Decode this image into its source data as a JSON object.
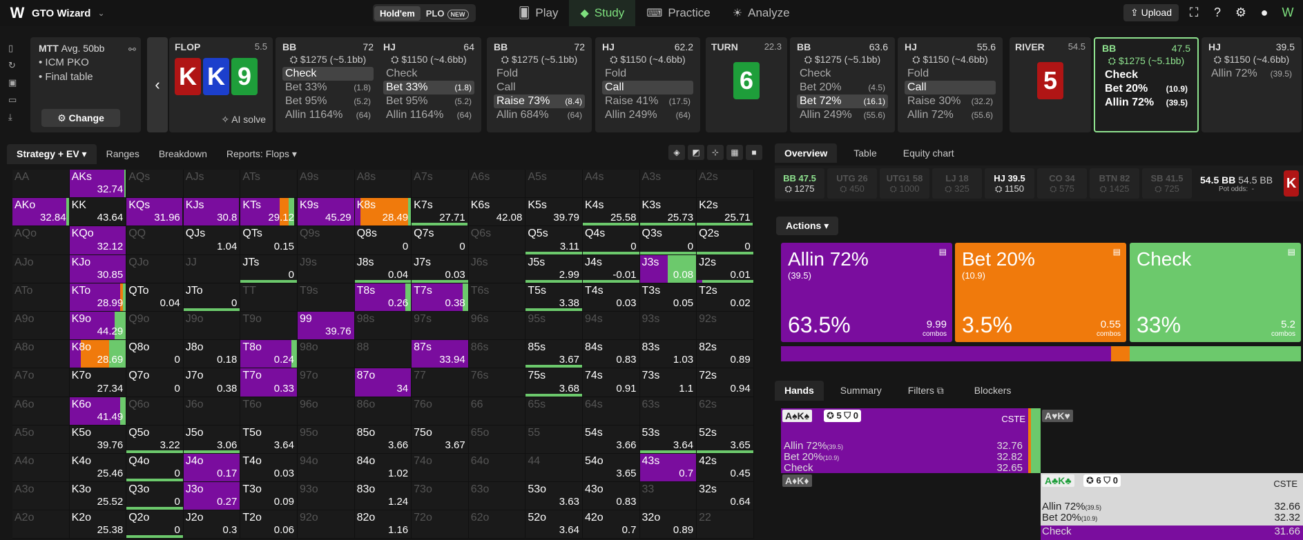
{
  "top": {
    "brand": "GTO Wizard",
    "holdem": "Hold'em",
    "plo": "PLO",
    "new_badge": "NEW",
    "nav": [
      "Play",
      "Study",
      "Practice",
      "Analyze"
    ],
    "upload": "Upload"
  },
  "spot": {
    "format": "MTT",
    "depth": "Avg. 50bb",
    "options": [
      "ICM PKO",
      "Final table"
    ],
    "change": "Change"
  },
  "streets": {
    "flop": {
      "label": "FLOP",
      "pot": "5.5",
      "cards": [
        "K",
        "K",
        "9"
      ],
      "ai": "AI solve"
    },
    "turn": {
      "label": "TURN",
      "pot": "22.3",
      "cards": [
        "6"
      ]
    },
    "river": {
      "label": "RIVER",
      "pot": "54.5",
      "cards": [
        "5"
      ]
    }
  },
  "players": [
    {
      "pos": "BB",
      "stack": "72",
      "bounty": "$1275 (~5.1bb)",
      "actions": [
        {
          "l": "Check",
          "n": "",
          "c": true
        },
        {
          "l": "Bet 33%",
          "n": "(1.8)"
        },
        {
          "l": "Bet 95%",
          "n": "(5.2)"
        },
        {
          "l": "Allin 1164%",
          "n": "(64)"
        }
      ]
    },
    {
      "pos": "HJ",
      "stack": "64",
      "bounty": "$1150 (~4.6bb)",
      "actions": [
        {
          "l": "Check",
          "n": ""
        },
        {
          "l": "Bet 33%",
          "n": "(1.8)",
          "c": true
        },
        {
          "l": "Bet 95%",
          "n": "(5.2)"
        },
        {
          "l": "Allin 1164%",
          "n": "(64)"
        }
      ]
    },
    {
      "pos": "BB",
      "stack": "72",
      "bounty": "$1275 (~5.1bb)",
      "actions": [
        {
          "l": "Fold",
          "n": ""
        },
        {
          "l": "Call",
          "n": ""
        },
        {
          "l": "Raise 73%",
          "n": "(8.4)",
          "c": true
        },
        {
          "l": "Allin 684%",
          "n": "(64)"
        }
      ]
    },
    {
      "pos": "HJ",
      "stack": "62.2",
      "bounty": "$1150 (~4.6bb)",
      "actions": [
        {
          "l": "Fold",
          "n": ""
        },
        {
          "l": "Call",
          "n": "",
          "c": true
        },
        {
          "l": "Raise 41%",
          "n": "(17.5)"
        },
        {
          "l": "Allin 249%",
          "n": "(64)"
        }
      ]
    },
    {
      "pos": "BB",
      "stack": "63.6",
      "bounty": "$1275 (~5.1bb)",
      "actions": [
        {
          "l": "Check",
          "n": ""
        },
        {
          "l": "Bet 20%",
          "n": "(4.5)"
        },
        {
          "l": "Bet 72%",
          "n": "(16.1)",
          "c": true
        },
        {
          "l": "Allin 249%",
          "n": "(55.6)"
        }
      ]
    },
    {
      "pos": "HJ",
      "stack": "55.6",
      "bounty": "$1150 (~4.6bb)",
      "actions": [
        {
          "l": "Fold",
          "n": ""
        },
        {
          "l": "Call",
          "n": "",
          "c": true
        },
        {
          "l": "Raise 30%",
          "n": "(32.2)"
        },
        {
          "l": "Allin 72%",
          "n": "(55.6)"
        }
      ]
    },
    {
      "pos": "BB",
      "stack": "47.5",
      "bounty": "$1275 (~5.1bb)",
      "actions": [
        {
          "l": "Check",
          "n": ""
        },
        {
          "l": "Bet 20%",
          "n": "(10.9)"
        },
        {
          "l": "Allin 72%",
          "n": "(39.5)"
        }
      ]
    },
    {
      "pos": "HJ",
      "stack": "39.5",
      "bounty": "$1150 (~4.6bb)",
      "actions": [
        {
          "l": "Allin 72%",
          "n": "(39.5)"
        }
      ]
    }
  ],
  "left_tabs": [
    "Strategy + EV",
    "Ranges",
    "Breakdown",
    "Reports: Flops"
  ],
  "grid": [
    [
      [
        "AA",
        "",
        0,
        0,
        0
      ],
      [
        "AKs",
        "32.74",
        1,
        0,
        0.03
      ],
      [
        "AQs",
        "",
        0,
        0,
        0
      ],
      [
        "AJs",
        "",
        0,
        0,
        0
      ],
      [
        "ATs",
        "",
        0,
        0,
        0
      ],
      [
        "A9s",
        "",
        0,
        0,
        0
      ],
      [
        "A8s",
        "",
        0,
        0,
        0
      ],
      [
        "A7s",
        "",
        0,
        0,
        0
      ],
      [
        "A6s",
        "",
        0,
        0,
        0
      ],
      [
        "A5s",
        "",
        0,
        0,
        0
      ],
      [
        "A4s",
        "",
        0,
        0,
        0
      ],
      [
        "A3s",
        "",
        0,
        0,
        0
      ],
      [
        "A2s",
        "",
        0,
        0,
        0
      ]
    ],
    [
      [
        "AKo",
        "32.84",
        0.95,
        0,
        0.05
      ],
      [
        "KK",
        "43.64",
        0,
        0,
        0
      ],
      [
        "KQs",
        "31.96",
        0.99,
        0,
        0
      ],
      [
        "KJs",
        "30.8",
        0.98,
        0,
        0
      ],
      [
        "KTs",
        "29.12",
        0.7,
        0.15,
        0.1
      ],
      [
        "K9s",
        "45.29",
        1,
        0,
        0
      ],
      [
        "K8s",
        "28.49",
        0.1,
        0.85,
        0.05
      ],
      [
        "K7s",
        "27.71",
        0,
        0,
        0.99
      ],
      [
        "K6s",
        "42.08",
        0,
        0,
        0
      ],
      [
        "K5s",
        "39.79",
        0,
        0,
        0
      ],
      [
        "K4s",
        "25.58",
        0,
        0,
        0.99
      ],
      [
        "K3s",
        "25.73",
        0,
        0,
        0.99
      ],
      [
        "K2s",
        "25.71",
        0,
        0,
        0.99
      ]
    ],
    [
      [
        "AQo",
        "",
        0,
        0,
        0
      ],
      [
        "KQo",
        "32.12",
        1,
        0,
        0
      ],
      [
        "QQ",
        "",
        0,
        0,
        0
      ],
      [
        "QJs",
        "1.04",
        0,
        0,
        0
      ],
      [
        "QTs",
        "0.15",
        0,
        0,
        0
      ],
      [
        "Q9s",
        "",
        0,
        0,
        0
      ],
      [
        "Q8s",
        "0",
        0,
        0,
        0
      ],
      [
        "Q7s",
        "0",
        0,
        0,
        0
      ],
      [
        "Q6s",
        "",
        0,
        0,
        0
      ],
      [
        "Q5s",
        "3.11",
        0,
        0,
        1
      ],
      [
        "Q4s",
        "0",
        0,
        0,
        1
      ],
      [
        "Q3s",
        "0",
        0,
        0,
        1
      ],
      [
        "Q2s",
        "0",
        0,
        0,
        1
      ]
    ],
    [
      [
        "AJo",
        "",
        0,
        0,
        0
      ],
      [
        "KJo",
        "30.85",
        1,
        0,
        0
      ],
      [
        "QJo",
        "",
        0,
        0,
        0
      ],
      [
        "JJ",
        "",
        0,
        0,
        0
      ],
      [
        "JTs",
        "0",
        0,
        0,
        1
      ],
      [
        "J9s",
        "",
        0,
        0,
        0
      ],
      [
        "J8s",
        "0.04",
        0,
        0,
        1
      ],
      [
        "J7s",
        "0.03",
        0,
        0,
        1
      ],
      [
        "J6s",
        "",
        0,
        0,
        0
      ],
      [
        "J5s",
        "2.99",
        0,
        0,
        1
      ],
      [
        "J4s",
        "-0.01",
        0,
        0,
        1
      ],
      [
        "J3s",
        "0.08",
        0.5,
        0,
        0.5
      ],
      [
        "J2s",
        "0.01",
        0.1,
        0,
        0.9
      ]
    ],
    [
      [
        "ATo",
        "",
        0,
        0,
        0
      ],
      [
        "KTo",
        "28.99",
        0.9,
        0.05,
        0.05
      ],
      [
        "QTo",
        "0.04",
        0,
        0,
        0
      ],
      [
        "JTo",
        "0",
        0,
        0,
        1
      ],
      [
        "TT",
        "",
        0,
        0,
        0
      ],
      [
        "T9s",
        "",
        0,
        0,
        0
      ],
      [
        "T8s",
        "0.26",
        0.9,
        0,
        0.1
      ],
      [
        "T7s",
        "0.38",
        0.9,
        0,
        0.1
      ],
      [
        "T6s",
        "",
        0,
        0,
        0
      ],
      [
        "T5s",
        "3.38",
        0,
        0,
        1
      ],
      [
        "T4s",
        "0.03",
        0,
        0,
        0
      ],
      [
        "T3s",
        "0.05",
        0,
        0,
        0
      ],
      [
        "T2s",
        "0.02",
        0,
        0,
        0
      ]
    ],
    [
      [
        "A9o",
        "",
        0,
        0,
        0
      ],
      [
        "K9o",
        "44.29",
        0.8,
        0,
        0.2
      ],
      [
        "Q9o",
        "",
        0,
        0,
        0
      ],
      [
        "J9o",
        "",
        0,
        0,
        0
      ],
      [
        "T9o",
        "",
        0,
        0,
        0
      ],
      [
        "99",
        "39.76",
        1,
        0,
        0
      ],
      [
        "98s",
        "",
        0,
        0,
        0
      ],
      [
        "97s",
        "",
        0,
        0,
        0
      ],
      [
        "96s",
        "",
        0,
        0,
        0
      ],
      [
        "95s",
        "",
        0,
        0,
        0
      ],
      [
        "94s",
        "",
        0,
        0,
        0
      ],
      [
        "93s",
        "",
        0,
        0,
        0
      ],
      [
        "92s",
        "",
        0,
        0,
        0
      ]
    ],
    [
      [
        "A8o",
        "",
        0,
        0,
        0
      ],
      [
        "K8o",
        "28.69",
        0.2,
        0.5,
        0.3
      ],
      [
        "Q8o",
        "0",
        0,
        0,
        0
      ],
      [
        "J8o",
        "0.18",
        0,
        0,
        0
      ],
      [
        "T8o",
        "0.24",
        0.9,
        0,
        0.1
      ],
      [
        "98o",
        "",
        0,
        0,
        0
      ],
      [
        "88",
        "",
        0,
        0,
        0
      ],
      [
        "87s",
        "33.94",
        1,
        0,
        0
      ],
      [
        "86s",
        "",
        0,
        0,
        0
      ],
      [
        "85s",
        "3.67",
        0,
        0,
        1
      ],
      [
        "84s",
        "0.83",
        0,
        0,
        0
      ],
      [
        "83s",
        "1.03",
        0,
        0,
        0
      ],
      [
        "82s",
        "0.89",
        0,
        0,
        0
      ]
    ],
    [
      [
        "A7o",
        "",
        0,
        0,
        0
      ],
      [
        "K7o",
        "27.34",
        0,
        0,
        0
      ],
      [
        "Q7o",
        "0",
        0,
        0,
        0
      ],
      [
        "J7o",
        "0.38",
        0,
        0,
        0
      ],
      [
        "T7o",
        "0.33",
        1,
        0,
        0
      ],
      [
        "97o",
        "",
        0,
        0,
        0
      ],
      [
        "87o",
        "34",
        1,
        0,
        0
      ],
      [
        "77",
        "",
        0,
        0,
        0
      ],
      [
        "76s",
        "",
        0,
        0,
        0
      ],
      [
        "75s",
        "3.68",
        0,
        0,
        1
      ],
      [
        "74s",
        "0.91",
        0,
        0,
        0
      ],
      [
        "73s",
        "1.1",
        0,
        0,
        0
      ],
      [
        "72s",
        "0.94",
        0,
        0,
        0
      ]
    ],
    [
      [
        "A6o",
        "",
        0,
        0,
        0
      ],
      [
        "K6o",
        "41.49",
        0.9,
        0,
        0.1
      ],
      [
        "Q6o",
        "",
        0,
        0,
        0
      ],
      [
        "J6o",
        "",
        0,
        0,
        0
      ],
      [
        "T6o",
        "",
        0,
        0,
        0
      ],
      [
        "96o",
        "",
        0,
        0,
        0
      ],
      [
        "86o",
        "",
        0,
        0,
        0
      ],
      [
        "76o",
        "",
        0,
        0,
        0
      ],
      [
        "66",
        "",
        0,
        0,
        0
      ],
      [
        "65s",
        "",
        0,
        0,
        0
      ],
      [
        "64s",
        "",
        0,
        0,
        0
      ],
      [
        "63s",
        "",
        0,
        0,
        0
      ],
      [
        "62s",
        "",
        0,
        0,
        0
      ]
    ],
    [
      [
        "A5o",
        "",
        0,
        0,
        0
      ],
      [
        "K5o",
        "39.76",
        0,
        0,
        0
      ],
      [
        "Q5o",
        "3.22",
        0,
        0,
        1
      ],
      [
        "J5o",
        "3.06",
        0,
        0,
        1
      ],
      [
        "T5o",
        "3.64",
        0,
        0,
        0
      ],
      [
        "95o",
        "",
        0,
        0,
        0
      ],
      [
        "85o",
        "3.66",
        0,
        0,
        0
      ],
      [
        "75o",
        "3.67",
        0,
        0,
        0
      ],
      [
        "65o",
        "",
        0,
        0,
        0
      ],
      [
        "55",
        "",
        0,
        0,
        0
      ],
      [
        "54s",
        "3.66",
        0,
        0,
        0
      ],
      [
        "53s",
        "3.64",
        0,
        0,
        1
      ],
      [
        "52s",
        "3.65",
        0,
        0,
        1
      ]
    ],
    [
      [
        "A4o",
        "",
        0,
        0,
        0
      ],
      [
        "K4o",
        "25.46",
        0,
        0,
        0
      ],
      [
        "Q4o",
        "0",
        0,
        0,
        1
      ],
      [
        "J4o",
        "0.17",
        1,
        0,
        0
      ],
      [
        "T4o",
        "0.03",
        0,
        0,
        0
      ],
      [
        "94o",
        "",
        0,
        0,
        0
      ],
      [
        "84o",
        "1.02",
        0,
        0,
        0
      ],
      [
        "74o",
        "",
        0,
        0,
        0
      ],
      [
        "64o",
        "",
        0,
        0,
        0
      ],
      [
        "44",
        "",
        0,
        0,
        0
      ],
      [
        "54o",
        "3.65",
        0,
        0,
        0
      ],
      [
        "43s",
        "0.7",
        1,
        0,
        0
      ],
      [
        "42s",
        "0.45",
        0,
        0,
        0
      ]
    ],
    [
      [
        "A3o",
        "",
        0,
        0,
        0
      ],
      [
        "K3o",
        "25.52",
        0,
        0,
        0
      ],
      [
        "Q3o",
        "0",
        0,
        0,
        1
      ],
      [
        "J3o",
        "0.27",
        1,
        0,
        0
      ],
      [
        "T3o",
        "0.09",
        0,
        0,
        0
      ],
      [
        "93o",
        "",
        0,
        0,
        0
      ],
      [
        "83o",
        "1.24",
        0,
        0,
        0
      ],
      [
        "73o",
        "",
        0,
        0,
        0
      ],
      [
        "63o",
        "",
        0,
        0,
        0
      ],
      [
        "53o",
        "3.63",
        0,
        0,
        0
      ],
      [
        "43o",
        "0.83",
        0,
        0,
        0
      ],
      [
        "33",
        "",
        0,
        0,
        0
      ],
      [
        "32s",
        "0.64",
        0,
        0,
        0
      ]
    ],
    [
      [
        "A2o",
        "",
        0,
        0,
        0
      ],
      [
        "K2o",
        "25.38",
        0,
        0,
        0
      ],
      [
        "Q2o",
        "0",
        0,
        0,
        1
      ],
      [
        "J2o",
        "0.3",
        0,
        0,
        0
      ],
      [
        "T2o",
        "0.06",
        0,
        0,
        0
      ],
      [
        "92o",
        "",
        0,
        0,
        0
      ],
      [
        "82o",
        "1.16",
        0,
        0,
        0
      ],
      [
        "72o",
        "",
        0,
        0,
        0
      ],
      [
        "62o",
        "",
        0,
        0,
        0
      ],
      [
        "52o",
        "3.64",
        0,
        0,
        0
      ],
      [
        "42o",
        "0.7",
        0,
        0,
        0
      ],
      [
        "32o",
        "0.89",
        0,
        0,
        0
      ],
      [
        "22",
        "",
        0,
        0,
        0
      ]
    ]
  ],
  "right_tabs": [
    "Overview",
    "Table",
    "Equity chart"
  ],
  "positions": [
    {
      "pos": "BB 47.5",
      "val": "1275",
      "cls": "bb"
    },
    {
      "pos": "UTG 26",
      "val": "450",
      "cls": ""
    },
    {
      "pos": "UTG1 58",
      "val": "1000",
      "cls": ""
    },
    {
      "pos": "LJ 18",
      "val": "325",
      "cls": ""
    },
    {
      "pos": "HJ 39.5",
      "val": "1150",
      "cls": "hj"
    },
    {
      "pos": "CO 34",
      "val": "575",
      "cls": ""
    },
    {
      "pos": "BTN 82",
      "val": "1425",
      "cls": ""
    },
    {
      "pos": "SB 41.5",
      "val": "725",
      "cls": ""
    }
  ],
  "pot": {
    "main": "54.5 BB",
    "alt": "54.5 BB",
    "odds_label": "Pot odds:",
    "odds": "-"
  },
  "actions_label": "Actions",
  "big": [
    {
      "title": "Allin 72%",
      "size": "(39.5)",
      "pct": "63.5%",
      "combos": "9.99",
      "color": "#7a0d9e"
    },
    {
      "title": "Bet 20%",
      "size": "(10.9)",
      "pct": "3.5%",
      "combos": "0.55",
      "color": "#f07a0c"
    },
    {
      "title": "Check",
      "size": "",
      "pct": "33%",
      "combos": "5.2",
      "color": "#6cc96c"
    }
  ],
  "combos_label": "combos",
  "freq": [
    63.5,
    3.5,
    33
  ],
  "hand_tabs": [
    "Hands",
    "Summary",
    "Filters",
    "Blockers"
  ],
  "hands": {
    "h1": "A♠K♠",
    "h1_b": "5",
    "h1_s": "0",
    "cste": "CSTE",
    "h1_lines": [
      [
        "Allin 72%",
        "(39.5)",
        "32.76"
      ],
      [
        "Bet 20%",
        "(10.9)",
        "32.82"
      ],
      [
        "Check",
        "",
        "32.65"
      ]
    ],
    "h2": "A♥K♥",
    "h3": "A♦K♦",
    "h4": "A♣K♣",
    "h4_b": "6",
    "h4_s": "0",
    "h4_lines": [
      [
        "Allin 72%",
        "(39.5)",
        "32.66"
      ],
      [
        "Bet 20%",
        "(10.9)",
        "32.32"
      ],
      [
        "Check",
        "",
        "31.66"
      ]
    ]
  }
}
